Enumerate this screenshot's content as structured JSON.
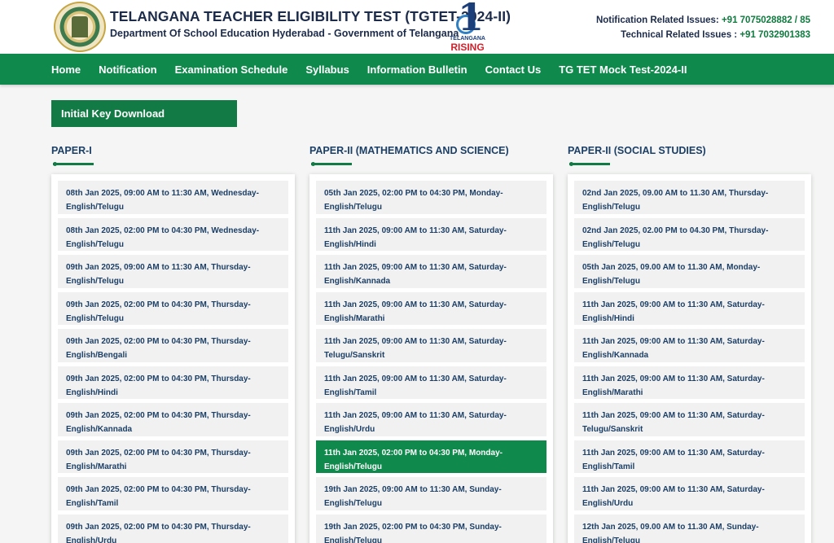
{
  "header": {
    "title": "TELANGANA TEACHER ELIGIBILITY TEST (TGTET-2024-II)",
    "subtitle": "Department Of School Education Hyderabad - Government of Telangana",
    "rising_small": "TELANGANA",
    "rising_big": "RISING",
    "notification_label": "Notification Related Issues: ",
    "notification_number": "+91 7075028882 / 85",
    "technical_label": "Technical Related Issues : ",
    "technical_number": "+91 7032901383"
  },
  "nav": {
    "items": [
      {
        "label": "Home"
      },
      {
        "label": "Notification"
      },
      {
        "label": "Examination Schedule"
      },
      {
        "label": "Syllabus"
      },
      {
        "label": "Information Bulletin"
      },
      {
        "label": "Contact Us"
      },
      {
        "label": "TG TET Mock Test-2024-II"
      }
    ]
  },
  "main": {
    "button_label": "Initial Key Download",
    "columns": [
      {
        "heading": "PAPER-I",
        "items": [
          {
            "line1": "08th Jan 2025, 09:00 AM to 11:30 AM, Wednesday-",
            "line2": "English/Telugu"
          },
          {
            "line1": "08th Jan 2025, 02:00 PM to 04:30 PM, Wednesday-",
            "line2": "English/Telugu"
          },
          {
            "line1": "09th Jan 2025, 09:00 AM to 11:30 AM, Thursday-",
            "line2": "English/Telugu"
          },
          {
            "line1": "09th Jan 2025, 02:00 PM to 04:30 PM, Thursday-",
            "line2": "English/Telugu"
          },
          {
            "line1": "09th Jan 2025, 02:00 PM to 04:30 PM, Thursday-",
            "line2": "English/Bengali"
          },
          {
            "line1": "09th Jan 2025, 02:00 PM to 04:30 PM, Thursday-",
            "line2": "English/Hindi"
          },
          {
            "line1": "09th Jan 2025, 02:00 PM to 04:30 PM, Thursday-",
            "line2": "English/Kannada"
          },
          {
            "line1": "09th Jan 2025, 02:00 PM to 04:30 PM, Thursday-",
            "line2": "English/Marathi"
          },
          {
            "line1": "09th Jan 2025, 02:00 PM to 04:30 PM, Thursday-",
            "line2": "English/Tamil"
          },
          {
            "line1": "09th Jan 2025, 02:00 PM to 04:30 PM, Thursday-",
            "line2": "English/Urdu"
          }
        ]
      },
      {
        "heading": "PAPER-II (MATHEMATICS AND SCIENCE)",
        "items": [
          {
            "line1": "05th Jan 2025, 02:00 PM to 04:30 PM, Monday-",
            "line2": "English/Telugu"
          },
          {
            "line1": "11th Jan 2025, 09:00 AM to 11:30 AM, Saturday-",
            "line2": "English/Hindi"
          },
          {
            "line1": "11th Jan 2025, 09:00 AM to 11:30 AM, Saturday-",
            "line2": "English/Kannada"
          },
          {
            "line1": "11th Jan 2025, 09:00 AM to 11:30 AM, Saturday-",
            "line2": "English/Marathi"
          },
          {
            "line1": "11th Jan 2025, 09:00 AM to 11:30 AM, Saturday-",
            "line2": "Telugu/Sanskrit"
          },
          {
            "line1": "11th Jan 2025, 09:00 AM to 11:30 AM, Saturday-",
            "line2": "English/Tamil"
          },
          {
            "line1": "11th Jan 2025, 09:00 AM to 11:30 AM, Saturday-",
            "line2": "English/Urdu"
          },
          {
            "line1": "11th Jan 2025, 02:00 PM to 04:30 PM, Monday-",
            "line2": "English/Telugu",
            "active": true
          },
          {
            "line1": "19th Jan 2025, 09:00 AM to 11:30 AM, Sunday-",
            "line2": "English/Telugu"
          },
          {
            "line1": "19th Jan 2025, 02:00 PM to 04:30 PM, Sunday-",
            "line2": "English/Telugu"
          }
        ]
      },
      {
        "heading": "PAPER-II (SOCIAL STUDIES)",
        "items": [
          {
            "line1": "02nd Jan 2025, 09.00 AM to 11.30 AM, Thursday-",
            "line2": "English/Telugu"
          },
          {
            "line1": "02nd Jan 2025, 02.00 PM to 04.30 PM, Thursday-",
            "line2": "English/Telugu"
          },
          {
            "line1": "05th Jan 2025, 09.00 AM to 11.30 AM, Monday-",
            "line2": "English/Telugu"
          },
          {
            "line1": "11th Jan 2025, 09:00 AM to 11:30 AM, Saturday-",
            "line2": "English/Hindi"
          },
          {
            "line1": "11th Jan 2025, 09:00 AM to 11:30 AM, Saturday-",
            "line2": "English/Kannada"
          },
          {
            "line1": "11th Jan 2025, 09:00 AM to 11:30 AM, Saturday-",
            "line2": "English/Marathi"
          },
          {
            "line1": "11th Jan 2025, 09:00 AM to 11:30 AM, Saturday-",
            "line2": "Telugu/Sanskrit"
          },
          {
            "line1": "11th Jan 2025, 09:00 AM to 11:30 AM, Saturday-",
            "line2": "English/Tamil"
          },
          {
            "line1": "11th Jan 2025, 09:00 AM to 11:30 AM, Saturday-",
            "line2": "English/Urdu"
          },
          {
            "line1": "12th Jan 2025, 09.00 AM to 11.30 AM, Sunday-",
            "line2": "English/Telugu"
          }
        ]
      }
    ]
  },
  "colors": {
    "brand_green": "#0f8a4c",
    "button_green": "#127a44",
    "heading_navy": "#1c3f66",
    "item_bg": "#f1f1f1"
  },
  "icons": [
    "telangana-emblem-icon",
    "telangana-rising-logo-icon"
  ]
}
